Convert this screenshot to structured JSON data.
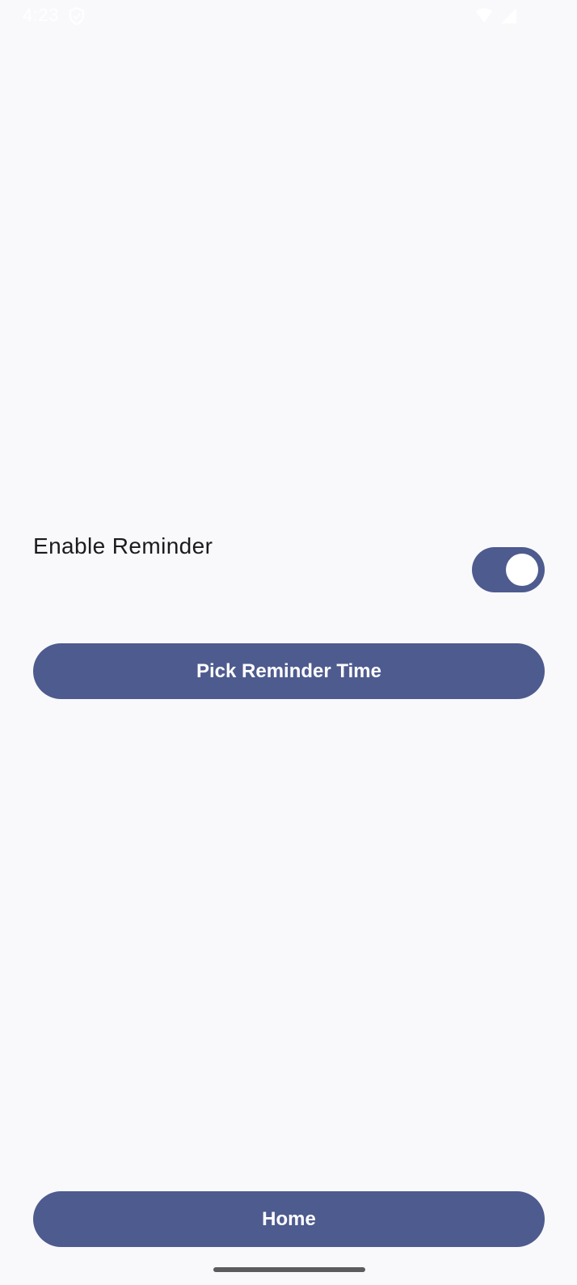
{
  "status_bar": {
    "time": "4:23",
    "icons": [
      "shield-icon",
      "wifi-icon",
      "signal-icon"
    ]
  },
  "settings": {
    "reminder_label": "Enable Reminder",
    "reminder_enabled": true
  },
  "buttons": {
    "pick_time_label": "Pick Reminder Time",
    "home_label": "Home"
  },
  "colors": {
    "accent": "#4e5b8f",
    "background": "#f9f9fb",
    "text": "#1b1b1f"
  }
}
